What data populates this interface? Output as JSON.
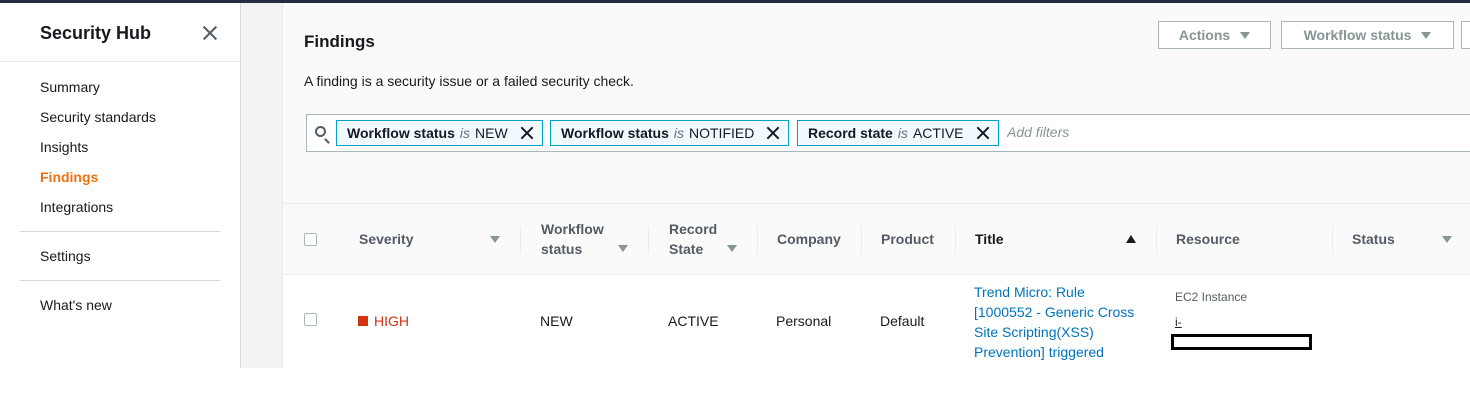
{
  "sidebar": {
    "title": "Security Hub",
    "items": [
      {
        "label": "Summary"
      },
      {
        "label": "Security standards"
      },
      {
        "label": "Insights"
      },
      {
        "label": "Findings"
      },
      {
        "label": "Integrations"
      }
    ],
    "settings": "Settings",
    "whats_new": "What's new",
    "active_color": "#ec7211"
  },
  "header": {
    "title": "Findings",
    "description": "A finding is a security issue or a failed security check.",
    "actions_label": "Actions",
    "workflow_status_label": "Workflow status"
  },
  "filters": {
    "tokens": [
      {
        "key": "Workflow status",
        "op": "is",
        "value": "NEW"
      },
      {
        "key": "Workflow status",
        "op": "is",
        "value": "NOTIFIED"
      },
      {
        "key": "Record state",
        "op": "is",
        "value": "ACTIVE"
      }
    ],
    "placeholder": "Add filters"
  },
  "table": {
    "columns": {
      "severity": "Severity",
      "workflow_status_1": "Workflow",
      "workflow_status_2": "status",
      "record_state_1": "Record",
      "record_state_2": "State",
      "company": "Company",
      "product": "Product",
      "title": "Title",
      "resource": "Resource",
      "status": "Status"
    },
    "rows": [
      {
        "severity": "HIGH",
        "workflow_status": "NEW",
        "record_state": "ACTIVE",
        "company": "Personal",
        "product": "Default",
        "title_lines": [
          "Trend Micro: Rule",
          "[1000552 - Generic Cross",
          "Site Scripting(XSS)",
          "Prevention] triggered"
        ],
        "resource_type": "EC2 Instance",
        "resource_id": "i-"
      }
    ]
  },
  "colors": {
    "link": "#0073bb",
    "severity_high": "#d13212",
    "token_border": "#00a1c9"
  }
}
